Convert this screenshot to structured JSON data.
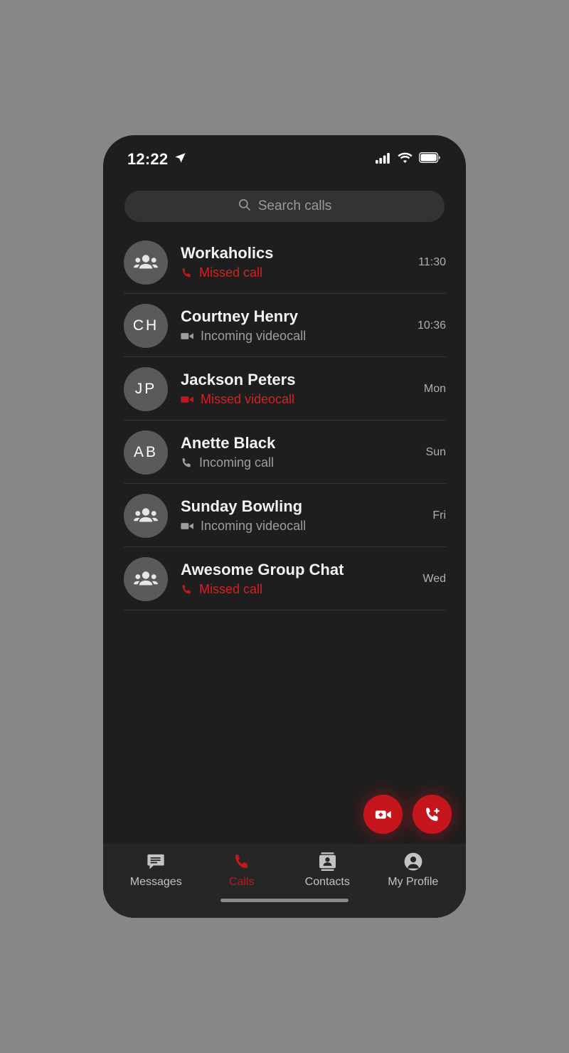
{
  "accent_color": "#c4161c",
  "status_bar": {
    "time": "12:22",
    "location_icon": "location-arrow-icon",
    "signal_icon": "cellular-signal-icon",
    "wifi_icon": "wifi-icon",
    "battery_icon": "battery-full-icon"
  },
  "search": {
    "placeholder": "Search calls",
    "icon": "search-icon",
    "value": ""
  },
  "calls": [
    {
      "name": "Workaholics",
      "avatar_type": "group",
      "initials": "",
      "status": "Missed call",
      "status_icon": "phone-icon",
      "missed": true,
      "time": "11:30"
    },
    {
      "name": "Courtney Henry",
      "avatar_type": "initials",
      "initials": "CH",
      "status": "Incoming videocall",
      "status_icon": "video-camera-icon",
      "missed": false,
      "time": "10:36"
    },
    {
      "name": "Jackson Peters",
      "avatar_type": "initials",
      "initials": "JP",
      "status": "Missed videocall",
      "status_icon": "video-camera-icon",
      "missed": true,
      "time": "Mon"
    },
    {
      "name": "Anette Black",
      "avatar_type": "initials",
      "initials": "AB",
      "status": "Incoming call",
      "status_icon": "phone-icon",
      "missed": false,
      "time": "Sun"
    },
    {
      "name": "Sunday Bowling",
      "avatar_type": "group",
      "initials": "",
      "status": "Incoming videocall",
      "status_icon": "video-camera-icon",
      "missed": false,
      "time": "Fri"
    },
    {
      "name": "Awesome Group Chat",
      "avatar_type": "group",
      "initials": "",
      "status": "Missed call",
      "status_icon": "phone-icon",
      "missed": true,
      "time": "Wed"
    }
  ],
  "fabs": [
    {
      "name": "new-videocall-button",
      "icon": "video-camera-plus-icon"
    },
    {
      "name": "new-call-button",
      "icon": "phone-plus-icon"
    }
  ],
  "bottom_nav": {
    "items": [
      {
        "label": "Messages",
        "icon": "chat-bubble-icon",
        "active": false
      },
      {
        "label": "Calls",
        "icon": "phone-icon",
        "active": true
      },
      {
        "label": "Contacts",
        "icon": "contact-card-icon",
        "active": false
      },
      {
        "label": "My Profile",
        "icon": "user-circle-icon",
        "active": false
      }
    ]
  }
}
